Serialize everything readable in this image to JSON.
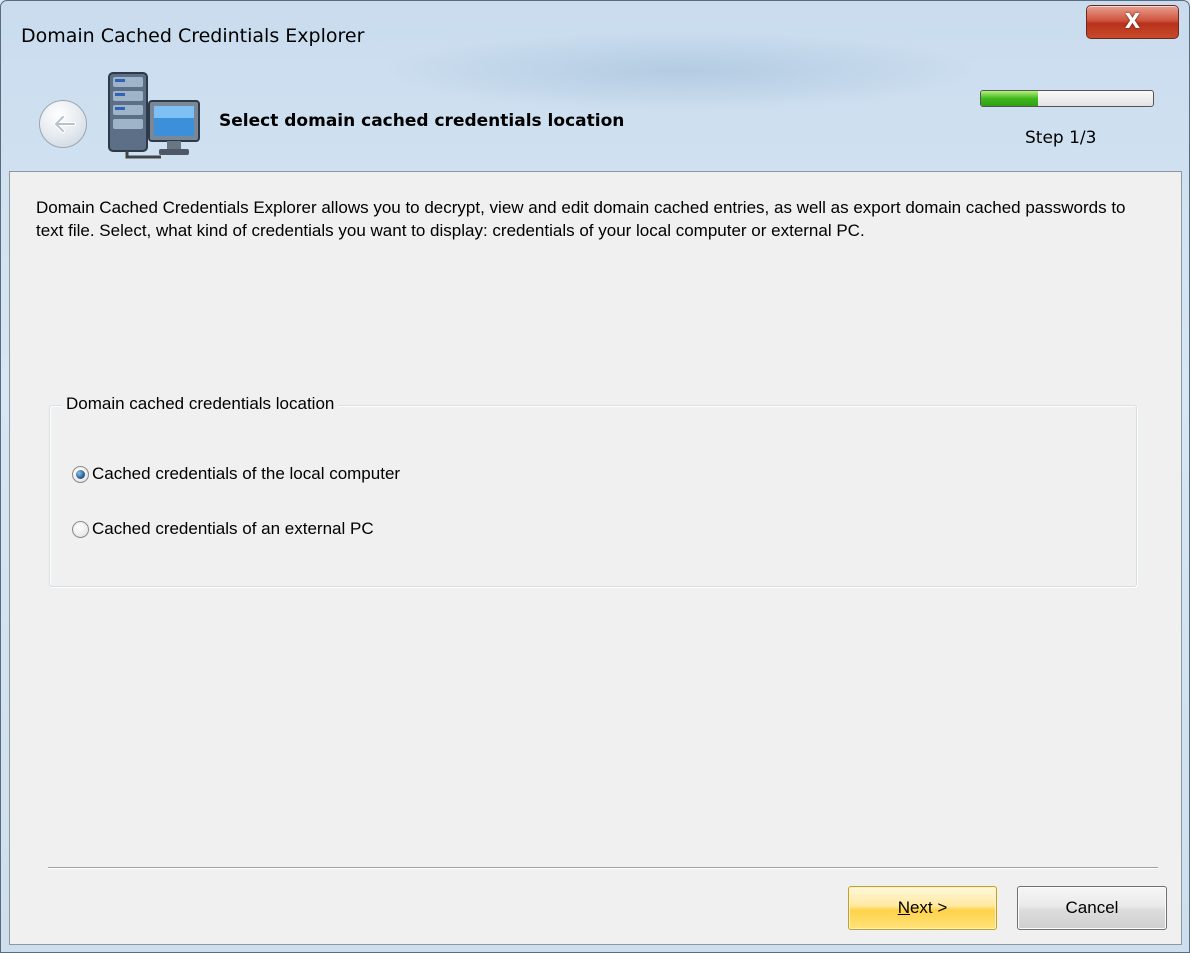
{
  "window": {
    "title": "Domain Cached Credintials Explorer",
    "close_label": "X"
  },
  "header": {
    "title": "Select domain cached credentials location",
    "step_label": "Step 1/3",
    "progress_fraction": 0.33,
    "back_icon": "back-arrow-icon",
    "app_icon": "server-computer-icon"
  },
  "description": "Domain Cached Credentials Explorer allows you to decrypt, view and edit domain cached entries, as well as export domain cached passwords to text file. Select, what kind of credentials you want to display: credentials of your local computer or external PC.",
  "location_group": {
    "legend": "Domain cached credentials location",
    "options": [
      {
        "label": "Cached credentials of the local computer",
        "checked": true
      },
      {
        "label": "Cached credentials of an external PC",
        "checked": false
      }
    ]
  },
  "footer": {
    "next_mnemonic": "N",
    "next_rest": "ext >",
    "cancel_label": "Cancel"
  },
  "colors": {
    "progress_green": "#41b81e",
    "next_button": "#ffd34a",
    "close_button": "#c84a2a"
  }
}
